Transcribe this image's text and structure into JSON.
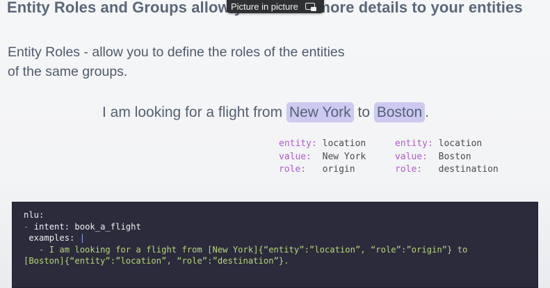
{
  "title": "Entity Roles and Groups allow you to add more details to your entities",
  "pip_overlay": {
    "label": "Picture in picture",
    "icon": "picture-in-picture-icon"
  },
  "description": {
    "line1": "Entity Roles - allow you to define the roles of the entities",
    "line2": "of the same groups."
  },
  "sentence": {
    "prefix": "I am looking for a flight from ",
    "entity1": "New York",
    "middle": " to ",
    "entity2": "Boston",
    "suffix": ".",
    "highlight_color": "#cdc9f0"
  },
  "annotations": [
    {
      "entity_key": "entity:",
      "entity_val": "location",
      "value_key": "value:",
      "value_val": "New York",
      "role_key": "role:",
      "role_val": "origin"
    },
    {
      "entity_key": "entity:",
      "entity_val": "location",
      "value_key": "value:",
      "value_val": "Boston",
      "role_key": "role:",
      "role_val": "destination"
    }
  ],
  "code": {
    "l1_key": "nlu:",
    "l2_dash": "- ",
    "l2_key": "intent:",
    "l2_val": "book_a_flight",
    "l3_key": "examples:",
    "l3_pipe": "|",
    "l4": "- I am looking for a flight from [New York]{“entity”:”location”, “role”:”origin”} to",
    "l5": "[Boston]{“entity”:”location”, “role”:”destination”}."
  }
}
